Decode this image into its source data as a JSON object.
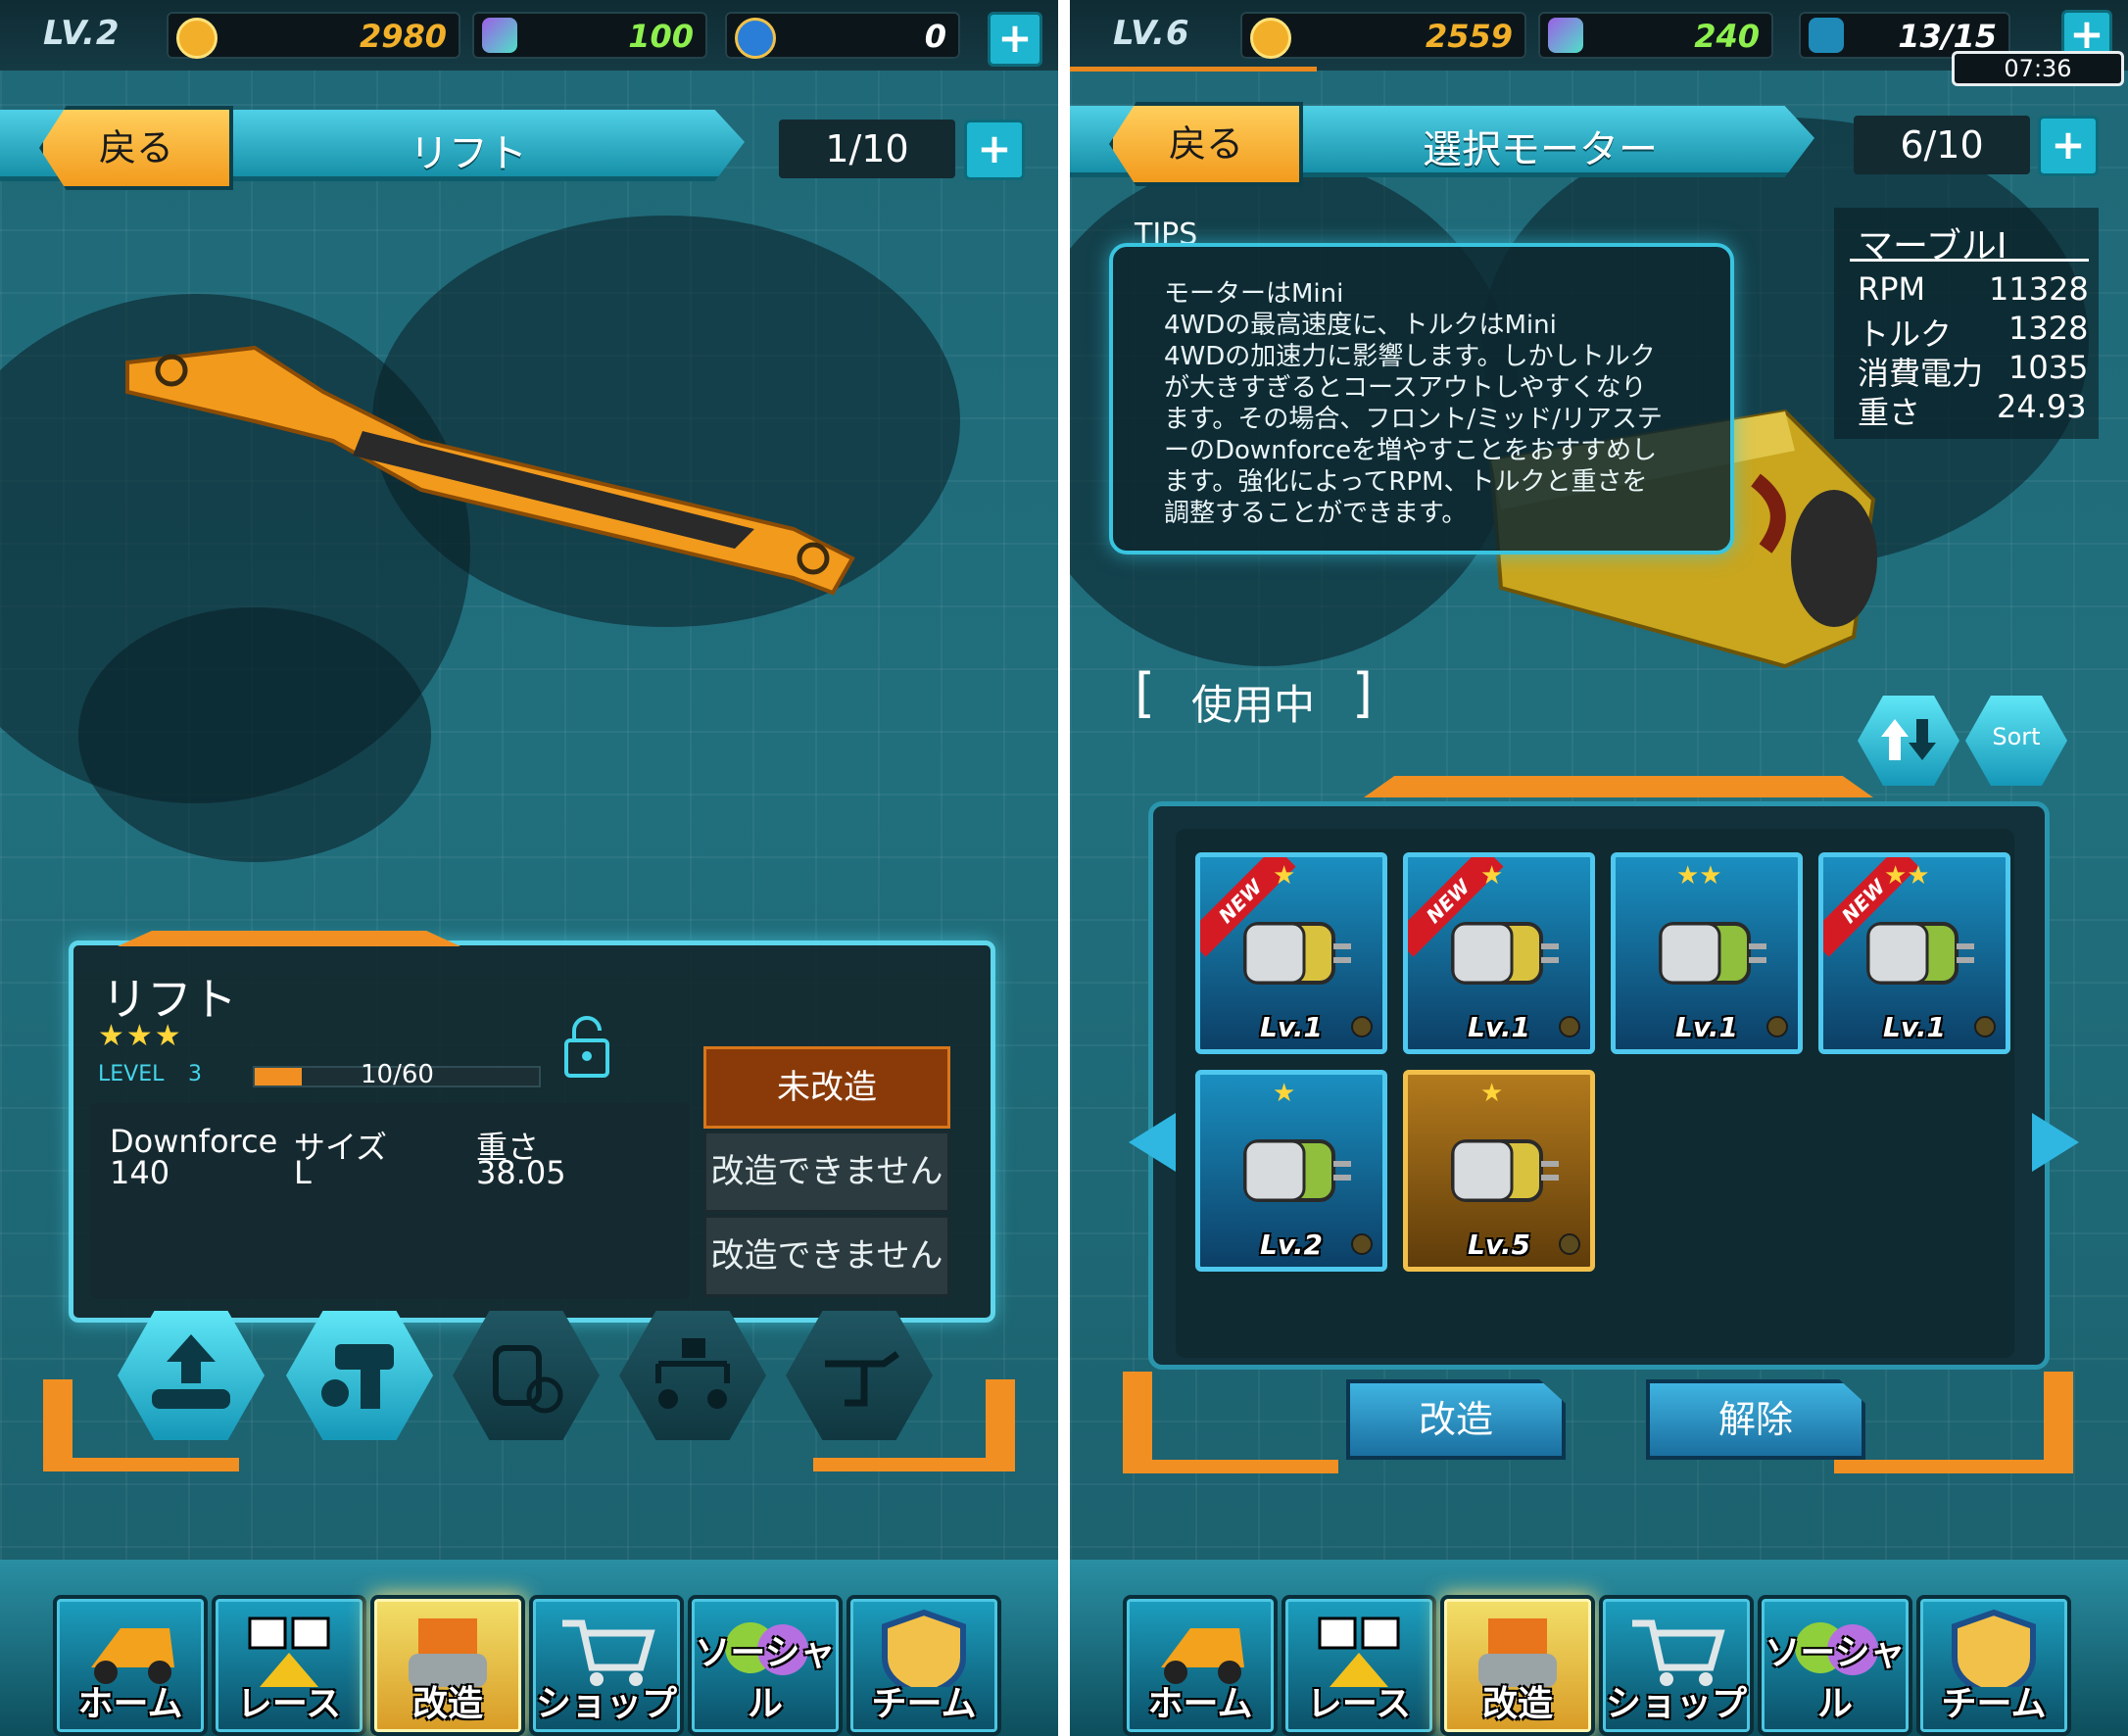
{
  "left": {
    "status": {
      "level": "LV.2",
      "coins": "2980",
      "gems": "100",
      "medals": "0"
    },
    "header": {
      "back": "戻る",
      "title": "リフト",
      "count": "1/10"
    },
    "card": {
      "name": "リフト",
      "stars": "★★★",
      "level_label": "LEVEL",
      "level_value": "3",
      "exp": "10/60",
      "exp_fraction": 0.1667,
      "stat1_label": "Downforce",
      "stat1_value": "140",
      "stat2_label": "サイズ",
      "stat2_value": "L",
      "stat3_label": "重さ",
      "stat3_value": "38.05",
      "mod_buttons": [
        "未改造",
        "改造できません",
        "改造できません"
      ]
    }
  },
  "right": {
    "status": {
      "level": "LV.6",
      "coins": "2559",
      "gems": "240",
      "stamina": "13/15",
      "timer": "07:36"
    },
    "header": {
      "back": "戻る",
      "title": "選択モーター",
      "count": "6/10"
    },
    "tips": {
      "title": "TIPS",
      "lines": [
        "モーターはMini",
        "4WDの最高速度に、トルクはMini",
        "4WDの加速力に影響します。しかしトルク",
        "が大きすぎるとコースアウトしやすくなり",
        "ます。その場合、フロント/ミッド/リアステ",
        "ーのDownforceを増やすことをおすすめし",
        "ます。強化によってRPM、トルクと重さを",
        "調整することができます。"
      ]
    },
    "motor_stats": {
      "name": "マーブルI",
      "rows": [
        {
          "label": "RPM",
          "value": "11328"
        },
        {
          "label": "トルク",
          "value": "1328"
        },
        {
          "label": "消費電力",
          "value": "1035"
        },
        {
          "label": "重さ",
          "value": "24.93"
        }
      ]
    },
    "in_use": "使用中",
    "sort_label": "Sort",
    "new_tag": "NEW",
    "slots": [
      {
        "level": "Lv.1",
        "stars": "★",
        "new": true,
        "color": "#d9c23e"
      },
      {
        "level": "Lv.1",
        "stars": "★",
        "new": true,
        "color": "#d9c23e"
      },
      {
        "level": "Lv.1",
        "stars": "★★",
        "new": false,
        "color": "#8fbf3c"
      },
      {
        "level": "Lv.1",
        "stars": "★★",
        "new": true,
        "color": "#8fbf3c"
      },
      {
        "level": "Lv.2",
        "stars": "★",
        "new": false,
        "color": "#8fbf3c"
      },
      {
        "level": "Lv.5",
        "stars": "★",
        "new": false,
        "color": "#d9c23e"
      }
    ],
    "actions": {
      "upgrade": "改造",
      "release": "解除"
    }
  },
  "nav": [
    "ホーム",
    "レース",
    "改造",
    "ショップ",
    "ソーシャル",
    "チーム"
  ],
  "colors": {
    "accent": "#1db5d0",
    "orange": "#f28f22",
    "gold": "#ffd53a"
  }
}
